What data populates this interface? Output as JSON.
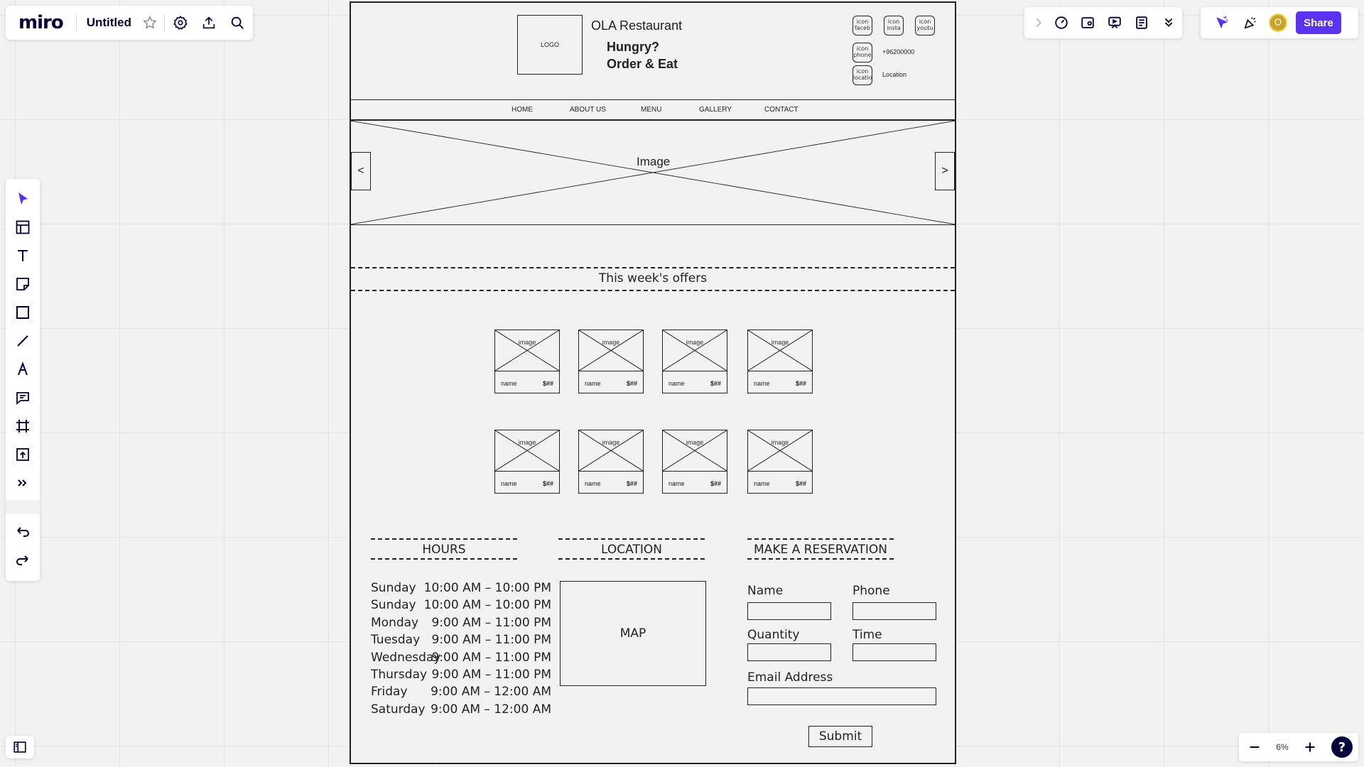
{
  "app": {
    "logo": "miro",
    "board_title": "Untitled"
  },
  "toolbar_right": {
    "share_label": "Share",
    "avatar_initial": "O",
    "zoom": "6%",
    "help": "?"
  },
  "wireframe": {
    "header": {
      "logo_placeholder": "LOGO",
      "restaurant_name": "OLA Restaurant",
      "tagline_1": "Hungry?",
      "tagline_2": "Order & Eat",
      "social_icons": [
        "icon faceb",
        "icon insta",
        "icon youtu"
      ],
      "phone_icon": "icon phone",
      "phone_number": "+96200000",
      "location_icon": "icon locatio",
      "location_text": "Location"
    },
    "nav": [
      "HOME",
      "ABOUT US",
      "MENU",
      "GALLERY",
      "CONTACT"
    ],
    "hero": {
      "label": "Image",
      "prev": "<",
      "next": ">"
    },
    "offers_title": "This week's offers",
    "offer_cards": [
      {
        "image": "image",
        "name": "name",
        "price": "$##"
      },
      {
        "image": "image",
        "name": "name",
        "price": "$##"
      },
      {
        "image": "image",
        "name": "name",
        "price": "$##"
      },
      {
        "image": "image",
        "name": "name",
        "price": "$##"
      },
      {
        "image": "image",
        "name": "name",
        "price": "$##"
      },
      {
        "image": "image",
        "name": "name",
        "price": "$##"
      },
      {
        "image": "image",
        "name": "name",
        "price": "$##"
      },
      {
        "image": "image",
        "name": "name",
        "price": "$##"
      }
    ],
    "hours": {
      "title": "HOURS",
      "rows": [
        {
          "day": "Sunday",
          "time": "10:00 AM – 10:00 PM"
        },
        {
          "day": "Sunday",
          "time": "10:00 AM – 10:00 PM"
        },
        {
          "day": "Monday",
          "time": "9:00 AM – 11:00 PM"
        },
        {
          "day": "Tuesday",
          "time": "9:00 AM – 11:00 PM"
        },
        {
          "day": "Wednesday",
          "time": "9:00 AM – 11:00 PM"
        },
        {
          "day": "Thursday",
          "time": "9:00 AM – 11:00 PM"
        },
        {
          "day": "Friday",
          "time": "9:00 AM – 12:00 AM"
        },
        {
          "day": "Saturday",
          "time": "9:00 AM – 12:00 AM"
        }
      ]
    },
    "location": {
      "title": "LOCATION",
      "map_label": "MAP"
    },
    "reservation": {
      "title": "MAKE A RESERVATION",
      "name_label": "Name",
      "phone_label": "Phone",
      "quantity_label": "Quantity",
      "time_label": "Time",
      "email_label": "Email Address",
      "submit_label": "Submit"
    }
  },
  "colors": {
    "accent": "#5b32f0",
    "ink": "#050038",
    "canvas": "#f2f2f2"
  }
}
